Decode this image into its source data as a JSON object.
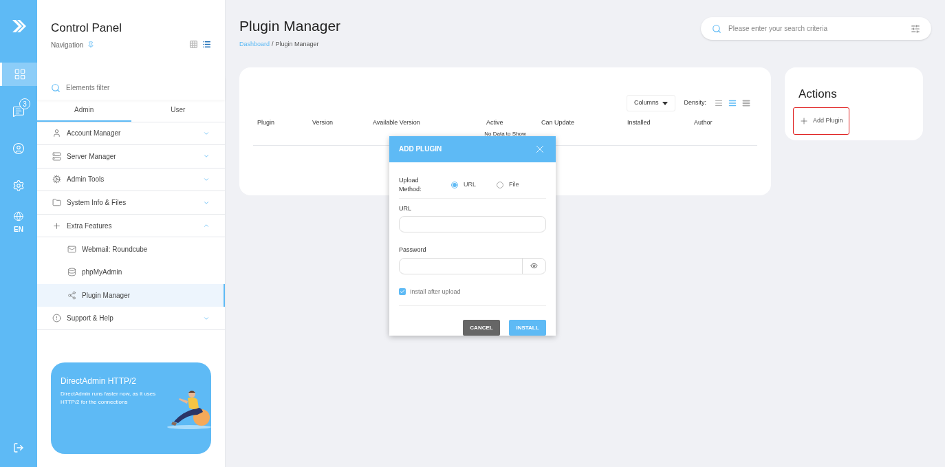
{
  "rail": {
    "items": [
      {
        "kind": "apps",
        "selected": true
      },
      {
        "kind": "messages",
        "selected": false,
        "badge": "3"
      },
      {
        "kind": "user",
        "selected": false
      },
      {
        "kind": "settings",
        "selected": false
      },
      {
        "kind": "language",
        "selected": false,
        "label": "EN"
      }
    ]
  },
  "sidebar": {
    "title": "Control Panel",
    "subtitle": "Navigation",
    "views": [
      {
        "kind": "grid",
        "selected": false
      },
      {
        "kind": "list",
        "selected": true
      }
    ],
    "filter": {
      "placeholder": "Elements filter"
    },
    "tabs": [
      {
        "label": "Admin",
        "selected": true
      },
      {
        "label": "User",
        "selected": false
      }
    ],
    "items": [
      {
        "label": "Account Manager",
        "expanded": false
      },
      {
        "label": "Server Manager",
        "expanded": false
      },
      {
        "label": "Admin Tools",
        "expanded": false
      },
      {
        "label": "System Info & Files",
        "expanded": false
      },
      {
        "label": "Extra Features",
        "expanded": true,
        "children": [
          {
            "label": "Webmail: Roundcube",
            "selected": false
          },
          {
            "label": "phpMyAdmin",
            "selected": false
          },
          {
            "label": "Plugin Manager",
            "selected": true
          }
        ]
      },
      {
        "label": "Support & Help",
        "expanded": false
      }
    ],
    "promo": {
      "title": "DirectAdmin HTTP/2",
      "text": "DirectAdmin runs faster now, as it uses HTTP/2 for the connections"
    }
  },
  "header": {
    "title": "Plugin Manager",
    "breadcrumb": {
      "link": "Dashboard",
      "separator": "/",
      "current": "Plugin Manager"
    },
    "search": {
      "placeholder": "Please enter your search criteria"
    }
  },
  "table": {
    "columns_button": "Columns",
    "density_label": "Density:",
    "density": [
      {
        "selected": false
      },
      {
        "selected": true
      },
      {
        "selected": false
      }
    ],
    "columns": [
      "Plugin",
      "Version",
      "Available Version",
      "Active",
      "Can Update",
      "Installed",
      "Author"
    ],
    "empty": "No Data to Show"
  },
  "actions": {
    "title": "Actions",
    "items": [
      {
        "label": "Add Plugin",
        "highlighted": true
      }
    ]
  },
  "dialog": {
    "title": "ADD PLUGIN",
    "method_label": "Upload Method:",
    "methods": [
      {
        "label": "URL",
        "selected": true
      },
      {
        "label": "File",
        "selected": false
      }
    ],
    "url_label": "URL",
    "password_label": "Password",
    "install_after": {
      "label": "Install after upload",
      "checked": true
    },
    "buttons": [
      {
        "label": "CANCEL",
        "kind": "secondary"
      },
      {
        "label": "INSTALL",
        "kind": "primary"
      }
    ]
  }
}
